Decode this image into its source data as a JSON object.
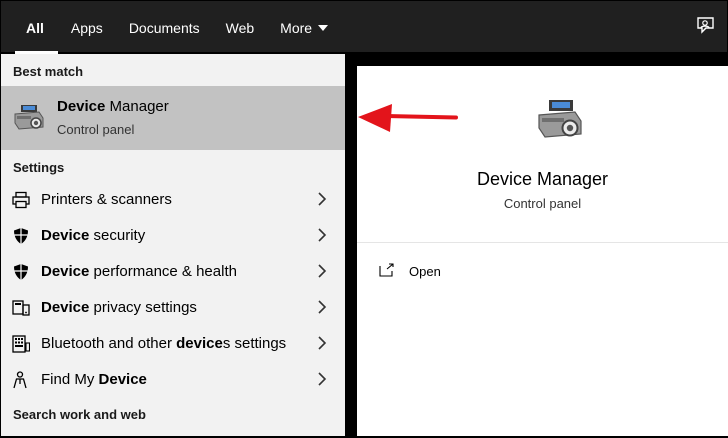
{
  "tabs": [
    {
      "label": "All",
      "active": true
    },
    {
      "label": "Apps"
    },
    {
      "label": "Documents"
    },
    {
      "label": "Web"
    },
    {
      "label": "More"
    }
  ],
  "left": {
    "best_match_heading": "Best match",
    "best_match": {
      "title_bold": "Device",
      "title_rest": " Manager",
      "subtitle": "Control panel",
      "icon": "device-manager-icon"
    },
    "settings_heading": "Settings",
    "settings": [
      {
        "pre": "",
        "bold": "",
        "post": "Printers & scanners",
        "icon": "printer-icon"
      },
      {
        "pre": "",
        "bold": "Device",
        "post": " security",
        "icon": "shield-icon"
      },
      {
        "pre": "",
        "bold": "Device",
        "post": " performance & health",
        "icon": "shield-icon"
      },
      {
        "pre": "",
        "bold": "Device",
        "post": " privacy settings",
        "icon": "devices-icon"
      },
      {
        "pre": "Bluetooth and other ",
        "bold": "device",
        "post": "s settings",
        "icon": "keyboard-icon"
      },
      {
        "pre": "Find My ",
        "bold": "Device",
        "post": "",
        "icon": "person-location-icon"
      }
    ],
    "web_heading": "Search work and web"
  },
  "preview": {
    "title": "Device Manager",
    "subtitle": "Control panel",
    "action_open": "Open"
  },
  "colors": {
    "topbar": "#202020",
    "pane": "#f2f2f2",
    "selected": "#c2c2c2",
    "arrow": "#e3141b"
  }
}
